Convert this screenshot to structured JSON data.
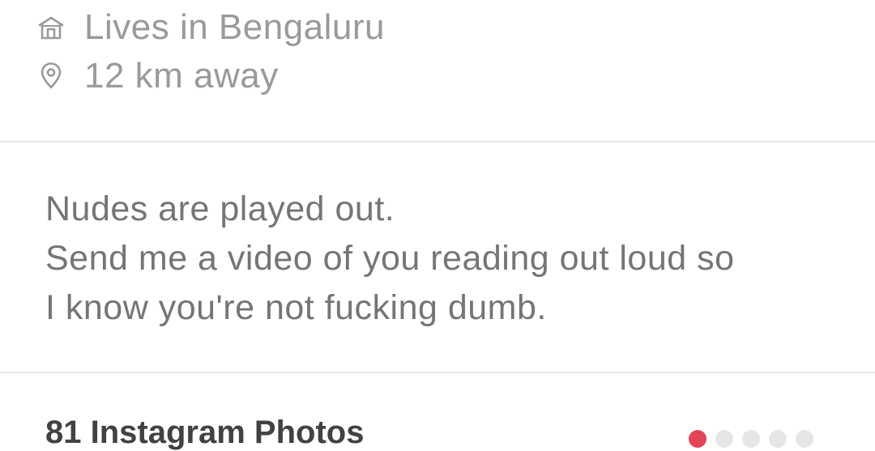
{
  "profile_info": {
    "lives_in": "Lives in Bengaluru",
    "distance": "12 km away",
    "home_icon": "home-icon",
    "location_icon": "location-pin-icon"
  },
  "bio": {
    "lines": [
      "Nudes are played out.",
      "Send me a video of you reading out loud so",
      "I know you're not fucking dumb."
    ]
  },
  "instagram": {
    "title": "81 Instagram Photos",
    "page_count": 5,
    "active_page": 1
  },
  "colors": {
    "text_muted": "#9a9a9a",
    "bio_text": "#757575",
    "heading_text": "#424242",
    "accent": "#e34457",
    "divider": "#e8e8e8",
    "dot_inactive": "#e6e6e6"
  }
}
